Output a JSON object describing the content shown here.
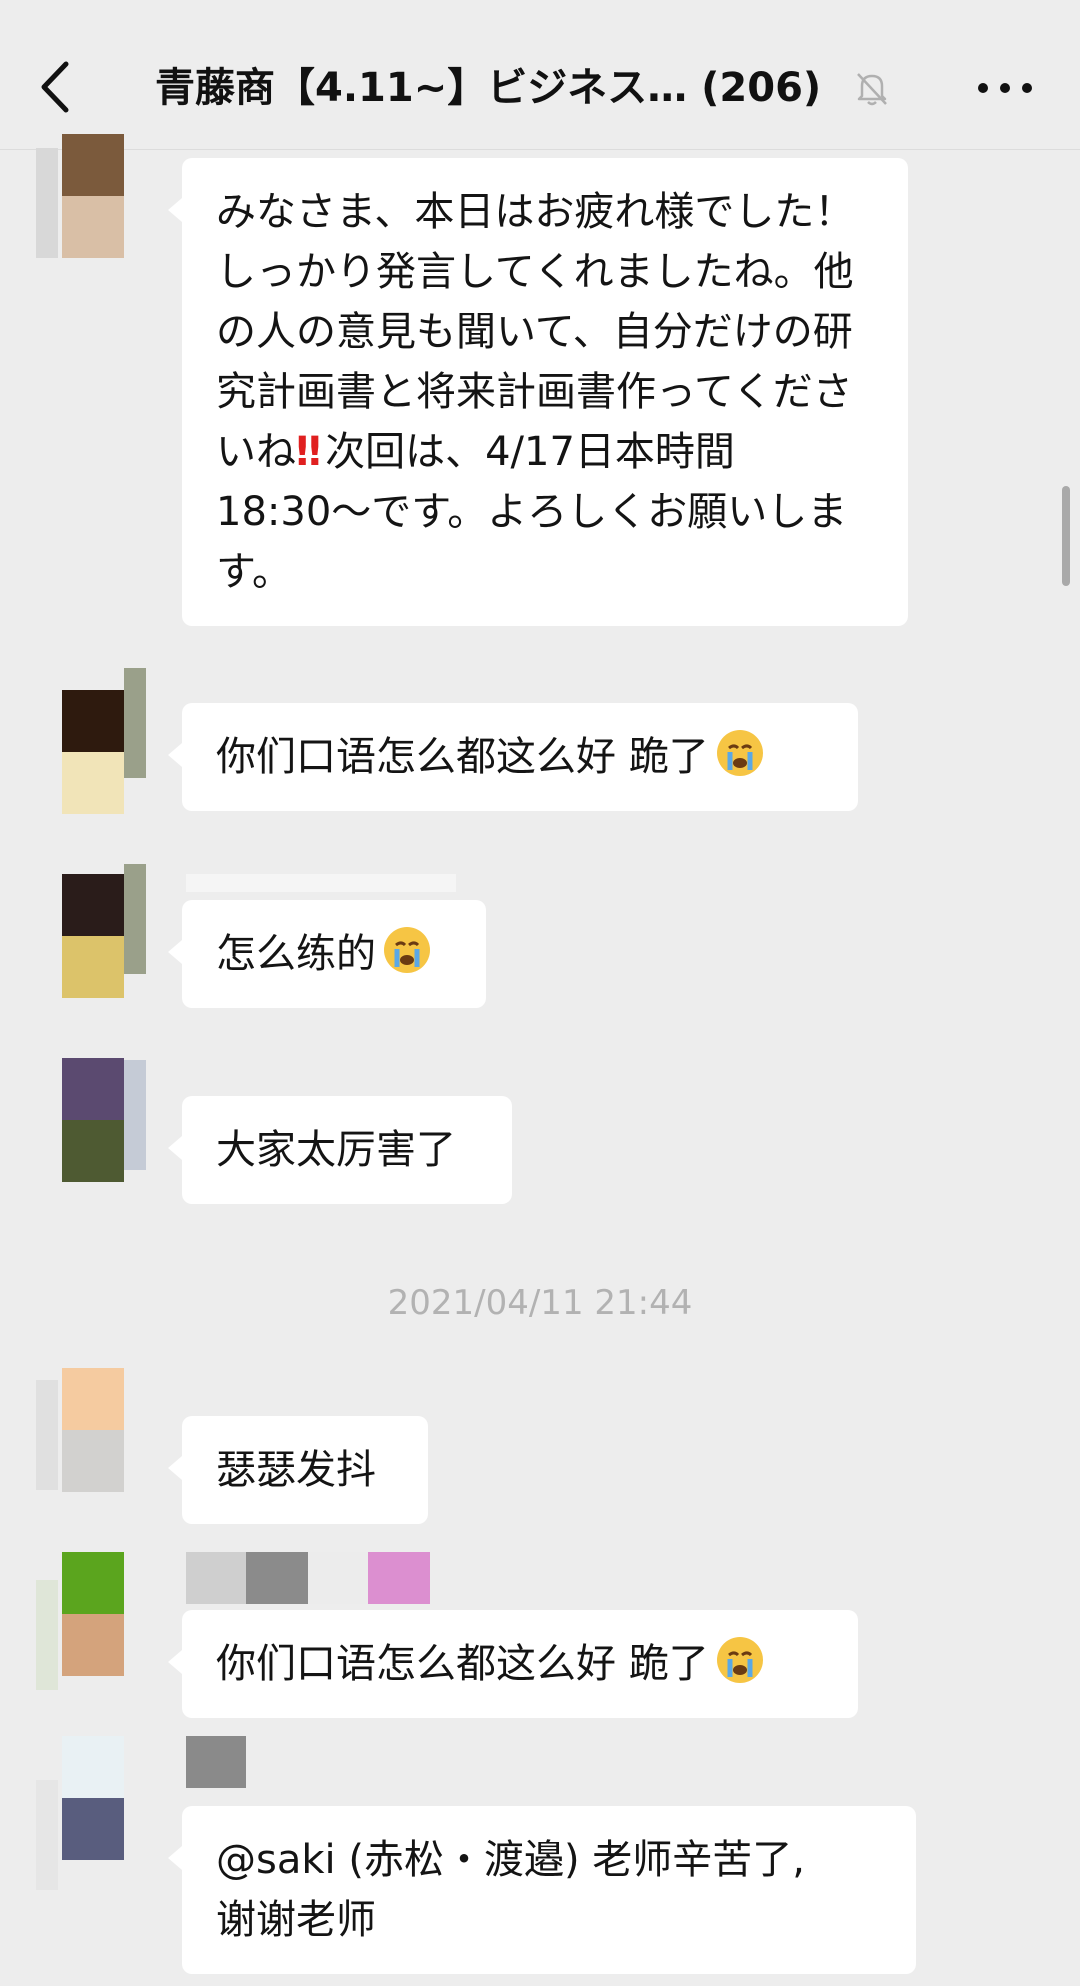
{
  "header": {
    "title": "青藤商【4.11~】ビジネス… (206)",
    "back_icon": "chevron-left-icon",
    "mute_icon": "bell-muted-icon",
    "more_icon": "more-dots-icon"
  },
  "messages": [
    {
      "text": "みなさま、本日はお疲れ様でした！しっかり発言してくれましたね。他の人の意見も聞いて、自分だけの研究計画書と将来計画書作ってくださいね",
      "text_after": "次回は、4/17日本時間18:30〜です。よろしくお願いします。",
      "exclaim": "‼"
    },
    {
      "text": "你们口语怎么都这么好 跪了",
      "emoji": "crying-face-icon"
    },
    {
      "text": "怎么练的",
      "emoji": "crying-face-icon"
    },
    {
      "text": "大家太厉害了"
    },
    {
      "text": "瑟瑟发抖"
    },
    {
      "text": "你们口语怎么都这么好 跪了",
      "emoji": "crying-face-icon"
    },
    {
      "text_line1": "@saki (赤松・渡邉) 老师辛苦了,",
      "text_line2": "谢谢老师"
    }
  ],
  "timestamp": "2021/04/11 21:44",
  "colors": {
    "background": "#ededed",
    "bubble": "#ffffff",
    "timestamp": "#b2b2b2",
    "exclaim": "#e02020"
  }
}
